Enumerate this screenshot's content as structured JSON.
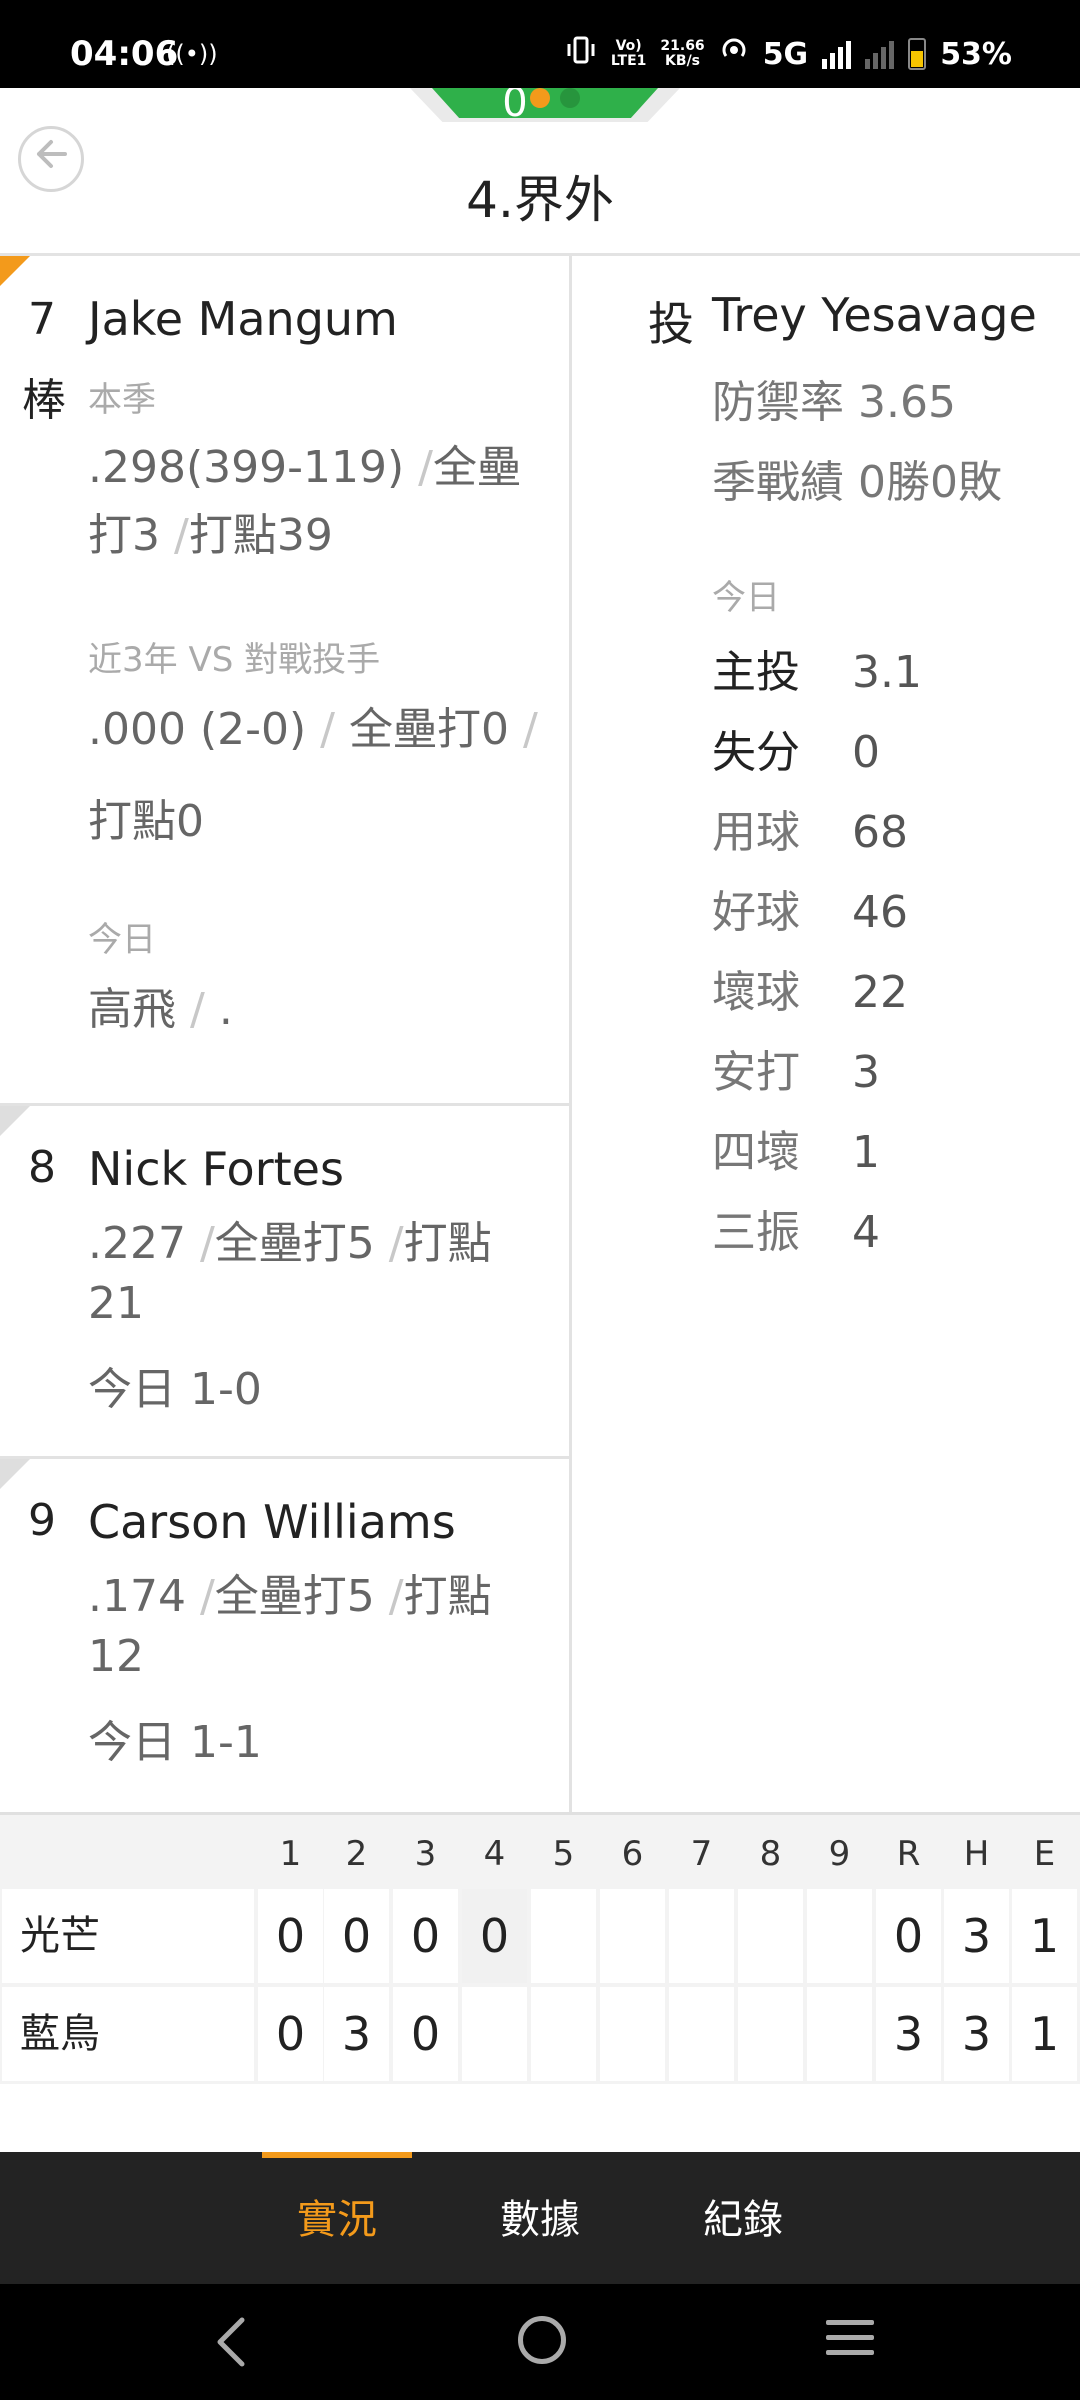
{
  "status_bar": {
    "time": "04:06",
    "cast_icon": "((•))",
    "volte": "Vo)\nLTE1",
    "speed": "21.66\nKB/s",
    "network": "5G",
    "battery": "53%",
    "icons": [
      "vibrate-icon",
      "hotspot-icon",
      "signal-icon",
      "battery-icon"
    ]
  },
  "header": {
    "score_fragment": "0",
    "title": "4.界外",
    "back_icon": "arrow-left-icon"
  },
  "batters": [
    {
      "order": "7",
      "side": "棒",
      "name": "Jake Mangum",
      "season_label": "本季",
      "season_avg": ".298(399-119)",
      "season_hr": "全壘打3",
      "season_rbi": "打點39",
      "vs_label": "近3年 VS 對戰投手",
      "vs_avg": ".000 (2-0)",
      "vs_hr": "全壘打0",
      "vs_rbi": "打點0",
      "today_label": "今日",
      "today_result": "高飛",
      "today_next": "."
    },
    {
      "order": "8",
      "name": "Nick Fortes",
      "avg": ".227",
      "hr": "全壘打5",
      "rbi": "打點",
      "rbi_value": "21",
      "today": "今日 1-0"
    },
    {
      "order": "9",
      "name": "Carson Williams",
      "avg": ".174",
      "hr": "全壘打5",
      "rbi": "打點",
      "rbi_value": "12",
      "today": "今日 1-1"
    }
  ],
  "pitcher": {
    "role": "投",
    "name": "Trey Yesavage",
    "era": "防禦率 3.65",
    "record": "季戰績 0勝0敗",
    "today_label": "今日",
    "stats": [
      {
        "label": "主投",
        "value": "3.1"
      },
      {
        "label": "失分",
        "value": "0"
      },
      {
        "label": "用球",
        "value": "68"
      },
      {
        "label": "好球",
        "value": "46"
      },
      {
        "label": "壞球",
        "value": "22"
      },
      {
        "label": "安打",
        "value": "3"
      },
      {
        "label": "四壞",
        "value": "1"
      },
      {
        "label": "三振",
        "value": "4"
      }
    ]
  },
  "scoreboard": {
    "headers": [
      "1",
      "2",
      "3",
      "4",
      "5",
      "6",
      "7",
      "8",
      "9",
      "R",
      "H",
      "E"
    ],
    "rows": [
      {
        "team": "光芒",
        "innings": [
          "0",
          "0",
          "0",
          "0",
          "",
          "",
          "",
          "",
          ""
        ],
        "R": "0",
        "H": "3",
        "E": "1"
      },
      {
        "team": "藍鳥",
        "innings": [
          "0",
          "3",
          "0",
          "",
          "",
          "",
          "",
          "",
          ""
        ],
        "R": "3",
        "H": "3",
        "E": "1"
      }
    ]
  },
  "bottom_nav": {
    "tabs": [
      "實況",
      "數據",
      "紀錄"
    ],
    "active": 0
  },
  "colors": {
    "accent": "#f39a1b",
    "field_green": "#2fb04a",
    "nav_bg": "#232323"
  }
}
